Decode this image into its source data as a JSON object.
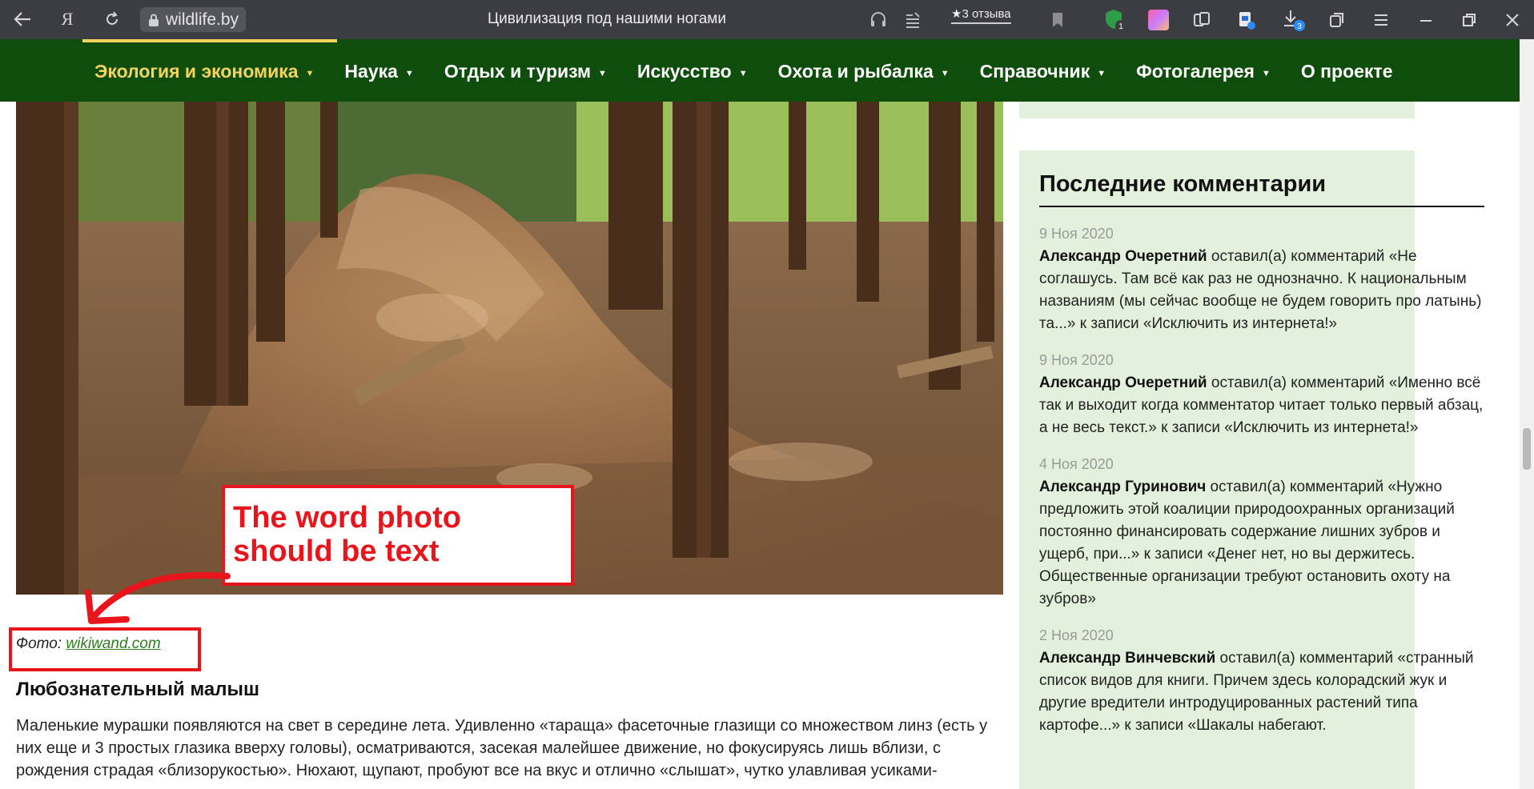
{
  "browser": {
    "url": "wildlife.by",
    "title": "Цивилизация под нашими ногами",
    "reviews_label": "★3 отзыва",
    "downloads_badge": "3",
    "shield_badge": "1"
  },
  "nav": {
    "items": [
      {
        "label": "Экология и экономика",
        "active": true,
        "has_dropdown": true
      },
      {
        "label": "Наука",
        "active": false,
        "has_dropdown": true
      },
      {
        "label": "Отдых и туризм",
        "active": false,
        "has_dropdown": true
      },
      {
        "label": "Искусство",
        "active": false,
        "has_dropdown": true
      },
      {
        "label": "Охота и рыбалка",
        "active": false,
        "has_dropdown": true
      },
      {
        "label": "Справочник",
        "active": false,
        "has_dropdown": true
      },
      {
        "label": "Фотогалерея",
        "active": false,
        "has_dropdown": true
      },
      {
        "label": "О проекте",
        "active": false,
        "has_dropdown": false
      }
    ],
    "caret": "▼"
  },
  "article": {
    "photo_alt": "anthill in a pine forest",
    "caption_prefix": "Фото: ",
    "caption_link": "wikiwand.com",
    "section_heading": "Любознательный малыш",
    "paragraph": "Маленькие мурашки появляются на свет в середине лета. Удивленно «тараща» фасеточные глазищи со множеством линз (есть у них еще и 3 простых глазика вверху головы), осматриваются, засекая малейшее движение, но фокусируясь лишь вблизи, с рождения страдая «близорукостью». Нюхают, щупают, пробуют все на вкус и отлично «слышат», чутко улавливая усиками-"
  },
  "annotation": {
    "text": "The word photo should be text"
  },
  "sidebar": {
    "title": "Последние комментарии",
    "comments": [
      {
        "date": "9 Ноя 2020",
        "author": "Александр Очеретний",
        "text": " оставил(а) комментарий «Не соглашусь. Там всё как раз не однозначно. К национальным названиям (мы сейчас вообще не будем говорить про латынь) та...» к записи «Исключить из интернета!»"
      },
      {
        "date": "9 Ноя 2020",
        "author": "Александр Очеретний",
        "text": " оставил(а) комментарий «Именно всё так и выходит когда комментатор читает только первый абзац, а не весь текст.» к записи «Исключить из интернета!»"
      },
      {
        "date": "4 Ноя 2020",
        "author": "Александр Гуринович",
        "text": " оставил(а) комментарий «Нужно предложить этой коалиции природоохранных организаций постоянно финансировать содержание лишних зубров и ущерб, при...» к записи «Денег нет, но вы держитесь. Общественные организации требуют остановить охоту на зубров»"
      },
      {
        "date": "2 Ноя 2020",
        "author": "Александр Винчевский",
        "text": " оставил(а) комментарий «странный список видов для книги. Причем здесь колорадский жук и другие вредители интродуцированных растений типа картофе...» к записи «Шакалы набегают."
      }
    ]
  },
  "colors": {
    "nav_bg": "#0e4d0b",
    "nav_active": "#f4d35e",
    "sidebar_bg": "#e3f1dc",
    "link_green": "#2e7d1e",
    "annotation_red": "#e8161c"
  }
}
